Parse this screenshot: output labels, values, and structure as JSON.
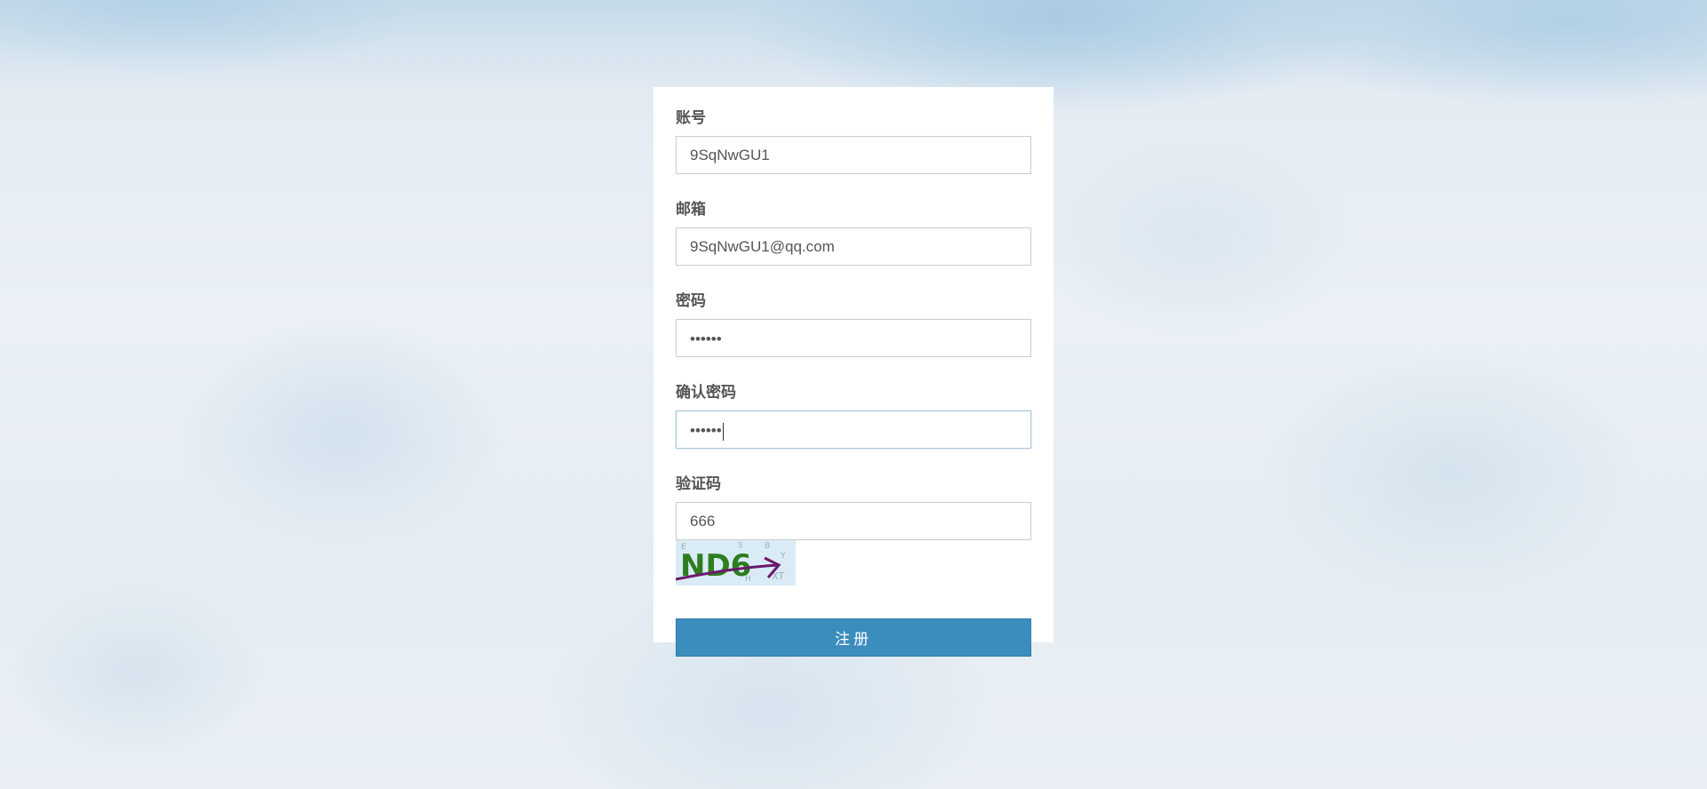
{
  "form": {
    "account": {
      "label": "账号",
      "value": "9SqNwGU1"
    },
    "email": {
      "label": "邮箱",
      "value": "9SqNwGU1@qq.com"
    },
    "password": {
      "label": "密码",
      "masked_value": "••••••"
    },
    "confirm_password": {
      "label": "确认密码",
      "masked_value": "••••••"
    },
    "captcha": {
      "label": "验证码",
      "value": "666",
      "image_text": "ND6"
    },
    "submit_label": "注册"
  },
  "colors": {
    "button": "#3b8dbd",
    "label": "#555555",
    "captcha_green": "#2e7d1f",
    "captcha_strike": "#6a1a6a"
  }
}
